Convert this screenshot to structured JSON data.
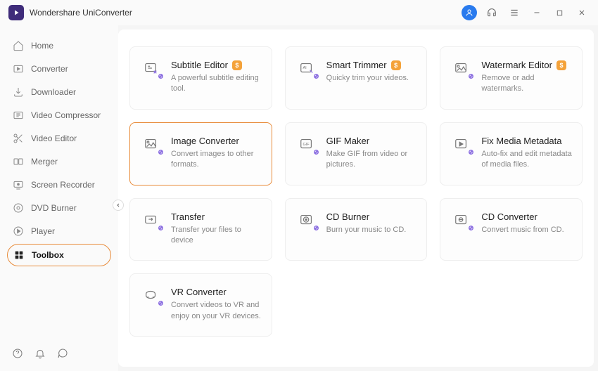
{
  "app": {
    "name": "Wondershare UniConverter"
  },
  "sidebar": {
    "items": [
      {
        "label": "Home"
      },
      {
        "label": "Converter"
      },
      {
        "label": "Downloader"
      },
      {
        "label": "Video Compressor"
      },
      {
        "label": "Video Editor"
      },
      {
        "label": "Merger"
      },
      {
        "label": "Screen Recorder"
      },
      {
        "label": "DVD Burner"
      },
      {
        "label": "Player"
      },
      {
        "label": "Toolbox"
      }
    ]
  },
  "tools": [
    {
      "title": "Subtitle Editor",
      "desc": "A powerful subtitle editing tool.",
      "badge": true
    },
    {
      "title": "Smart Trimmer",
      "desc": "Quicky trim your videos.",
      "badge": true
    },
    {
      "title": "Watermark Editor",
      "desc": "Remove or add watermarks.",
      "badge": true
    },
    {
      "title": "Image Converter",
      "desc": "Convert images to other formats.",
      "badge": false,
      "highlight": true
    },
    {
      "title": "GIF Maker",
      "desc": "Make GIF from video or pictures.",
      "badge": false
    },
    {
      "title": "Fix Media Metadata",
      "desc": "Auto-fix and edit metadata of media files.",
      "badge": false
    },
    {
      "title": "Transfer",
      "desc": "Transfer your files to device",
      "badge": false
    },
    {
      "title": "CD Burner",
      "desc": "Burn your music to CD.",
      "badge": false
    },
    {
      "title": "CD Converter",
      "desc": "Convert music from CD.",
      "badge": false
    },
    {
      "title": "VR Converter",
      "desc": "Convert videos to VR and enjoy on your VR devices.",
      "badge": false
    }
  ],
  "badge_text": "$"
}
